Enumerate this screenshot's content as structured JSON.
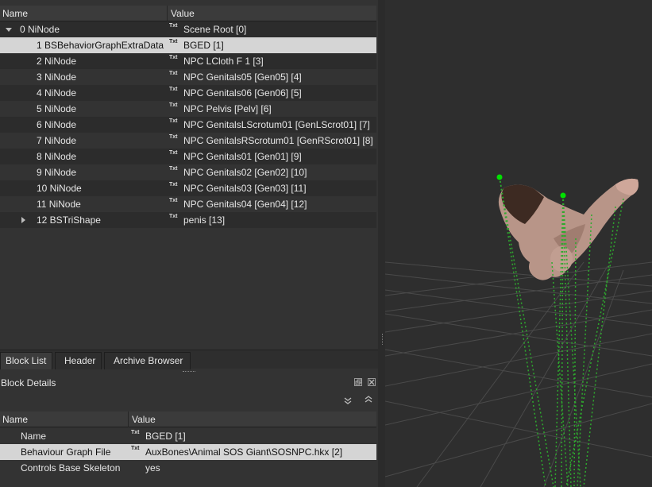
{
  "tree": {
    "columns": {
      "name": "Name",
      "value": "Value"
    },
    "rows": [
      {
        "name": "0 NiNode",
        "value": "Scene Root [0]",
        "indent": 1,
        "expander": "down"
      },
      {
        "name": "1 BSBehaviorGraphExtraData",
        "value": "BGED [1]",
        "indent": 2,
        "selected": true
      },
      {
        "name": "2 NiNode",
        "value": "NPC LCloth F 1 [3]",
        "indent": 2
      },
      {
        "name": "3 NiNode",
        "value": "NPC Genitals05 [Gen05] [4]",
        "indent": 2
      },
      {
        "name": "4 NiNode",
        "value": "NPC Genitals06 [Gen06] [5]",
        "indent": 2
      },
      {
        "name": "5 NiNode",
        "value": "NPC Pelvis [Pelv] [6]",
        "indent": 2
      },
      {
        "name": "6 NiNode",
        "value": "NPC GenitalsLScrotum01 [GenLScrot01] [7]",
        "indent": 2
      },
      {
        "name": "7 NiNode",
        "value": "NPC GenitalsRScrotum01 [GenRScrot01] [8]",
        "indent": 2
      },
      {
        "name": "8 NiNode",
        "value": "NPC Genitals01 [Gen01] [9]",
        "indent": 2
      },
      {
        "name": "9 NiNode",
        "value": "NPC Genitals02 [Gen02] [10]",
        "indent": 2
      },
      {
        "name": "10 NiNode",
        "value": "NPC Genitals03 [Gen03] [11]",
        "indent": 2
      },
      {
        "name": "11 NiNode",
        "value": "NPC Genitals04 [Gen04] [12]",
        "indent": 2
      },
      {
        "name": "12 BSTriShape",
        "value": "penis [13]",
        "indent": 2,
        "expander": "right"
      }
    ],
    "txt_badge": "Txt"
  },
  "tabs": [
    {
      "label": "Block List",
      "active": true
    },
    {
      "label": "Header",
      "active": false
    },
    {
      "label": "Archive Browser",
      "active": false
    }
  ],
  "details": {
    "title": "Block Details",
    "columns": {
      "name": "Name",
      "value": "Value"
    },
    "rows": [
      {
        "name": "Name",
        "value": "BGED [1]",
        "badge": true
      },
      {
        "name": "Behaviour Graph File",
        "value": "AuxBones\\Animal SOS Giant\\SOSNPC.hkx [2]",
        "badge": true,
        "selected": true
      },
      {
        "name": "Controls Base Skeleton",
        "value": "yes",
        "badge": false
      }
    ]
  },
  "colors": {
    "selection": "#d5d5d5",
    "node_marker": "#00e000",
    "bone_line": "#22a822"
  }
}
